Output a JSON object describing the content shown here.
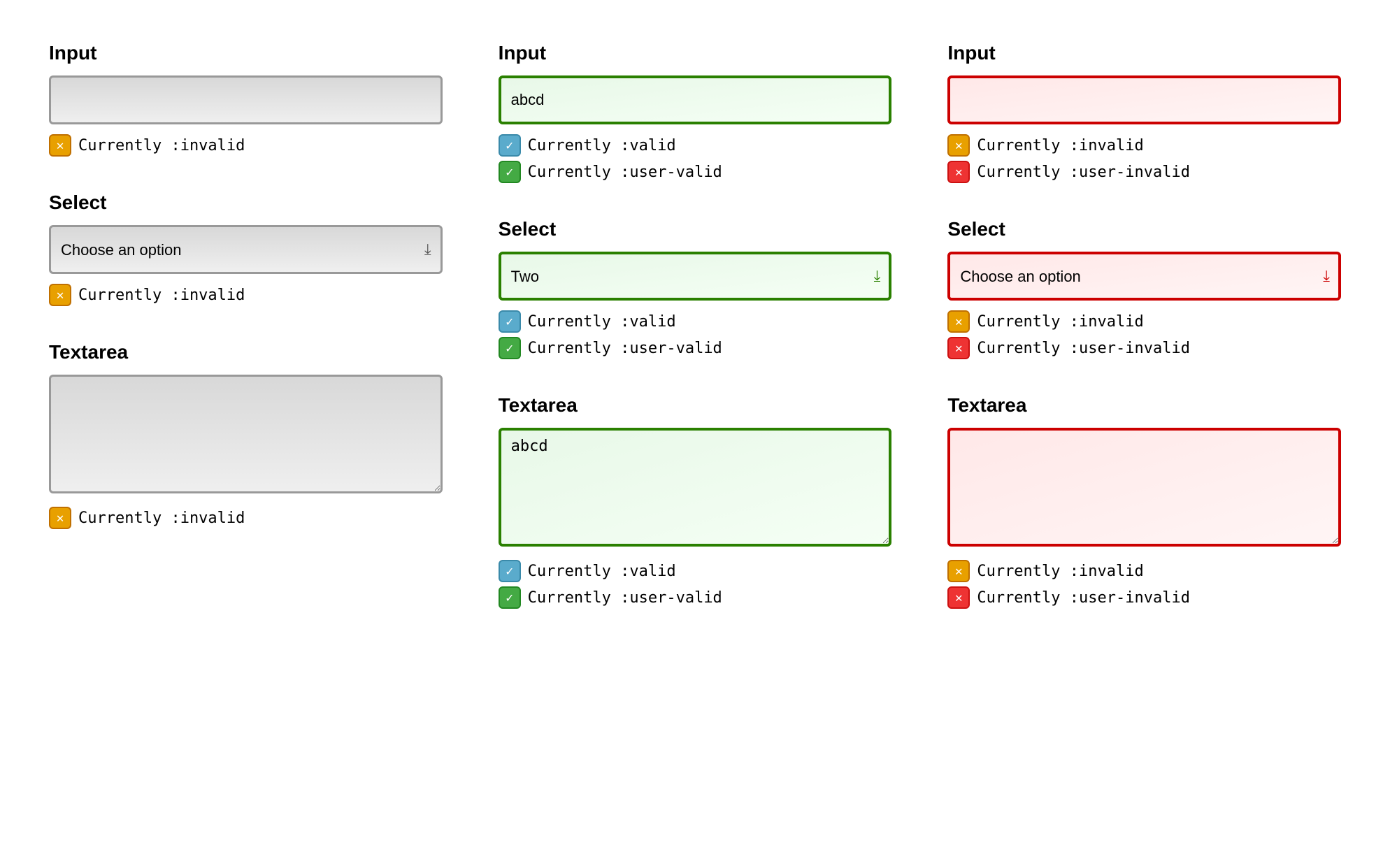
{
  "columns": [
    {
      "id": "neutral",
      "sections": [
        {
          "type": "input",
          "label": "Input",
          "value": "",
          "placeholder": "",
          "inputClass": "neutral-state",
          "statuses": [
            {
              "badge": "orange",
              "text": "Currently :invalid"
            }
          ]
        },
        {
          "type": "select",
          "label": "Select",
          "value": "",
          "placeholder": "Choose an option",
          "selectClass": "neutral-state",
          "chevronClass": "neutral",
          "statuses": [
            {
              "badge": "orange",
              "text": "Currently :invalid"
            }
          ]
        },
        {
          "type": "textarea",
          "label": "Textarea",
          "value": "",
          "textareaClass": "neutral-state",
          "statuses": [
            {
              "badge": "orange",
              "text": "Currently :invalid"
            }
          ]
        }
      ]
    },
    {
      "id": "valid",
      "sections": [
        {
          "type": "input",
          "label": "Input",
          "value": "abcd",
          "inputClass": "valid-state",
          "statuses": [
            {
              "badge": "blue",
              "text": "Currently :valid"
            },
            {
              "badge": "green",
              "text": "Currently :user-valid"
            }
          ]
        },
        {
          "type": "select",
          "label": "Select",
          "value": "Two",
          "selectClass": "valid-state",
          "chevronClass": "valid",
          "statuses": [
            {
              "badge": "blue",
              "text": "Currently :valid"
            },
            {
              "badge": "green",
              "text": "Currently :user-valid"
            }
          ]
        },
        {
          "type": "textarea",
          "label": "Textarea",
          "value": "abcd",
          "textareaClass": "valid-state",
          "statuses": [
            {
              "badge": "blue",
              "text": "Currently :valid"
            },
            {
              "badge": "green",
              "text": "Currently :user-valid"
            }
          ]
        }
      ]
    },
    {
      "id": "invalid",
      "sections": [
        {
          "type": "input",
          "label": "Input",
          "value": "",
          "inputClass": "invalid-state",
          "statuses": [
            {
              "badge": "orange",
              "text": "Currently :invalid"
            },
            {
              "badge": "red",
              "text": "Currently :user-invalid"
            }
          ]
        },
        {
          "type": "select",
          "label": "Select",
          "value": "",
          "placeholder": "Choose an option",
          "selectClass": "invalid-state",
          "chevronClass": "invalid",
          "statuses": [
            {
              "badge": "orange",
              "text": "Currently :invalid"
            },
            {
              "badge": "red",
              "text": "Currently :user-invalid"
            }
          ]
        },
        {
          "type": "textarea",
          "label": "Textarea",
          "value": "",
          "textareaClass": "invalid-state",
          "statuses": [
            {
              "badge": "orange",
              "text": "Currently :invalid"
            },
            {
              "badge": "red",
              "text": "Currently :user-invalid"
            }
          ]
        }
      ]
    }
  ],
  "badges": {
    "orange": "✕",
    "blue": "✓",
    "green": "✓",
    "red": "✕"
  }
}
